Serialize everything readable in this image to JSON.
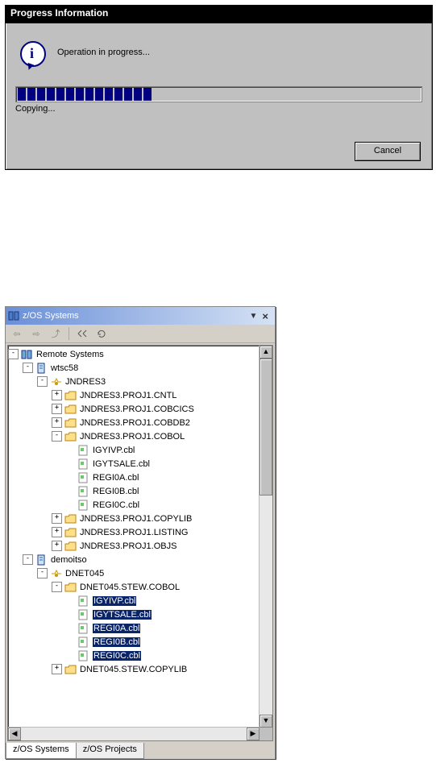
{
  "dialog": {
    "title": "Progress Information",
    "operation_text": "Operation in progress...",
    "status_text": "Copying...",
    "cancel_label": "Cancel",
    "progress_segments": 14
  },
  "view": {
    "title": "z/OS Systems",
    "tabs": [
      "z/OS Systems",
      "z/OS Projects"
    ],
    "active_tab": 0,
    "toolbar_icons": [
      "back-icon",
      "forward-icon",
      "up-icon",
      "connect-icon",
      "refresh-icon"
    ],
    "tree": [
      {
        "depth": 0,
        "expander": "-",
        "icon": "systems-icon",
        "label": "Remote Systems",
        "sel": false,
        "interact": true
      },
      {
        "depth": 1,
        "expander": "-",
        "icon": "host-icon",
        "label": "wtsc58",
        "sel": false,
        "interact": true
      },
      {
        "depth": 2,
        "expander": "-",
        "icon": "user-icon",
        "label": "JNDRES3",
        "sel": false,
        "interact": true
      },
      {
        "depth": 3,
        "expander": "+",
        "icon": "folder-icon",
        "label": "JNDRES3.PROJ1.CNTL",
        "sel": false,
        "interact": true
      },
      {
        "depth": 3,
        "expander": "+",
        "icon": "folder-icon",
        "label": "JNDRES3.PROJ1.COBCICS",
        "sel": false,
        "interact": true
      },
      {
        "depth": 3,
        "expander": "+",
        "icon": "folder-icon",
        "label": "JNDRES3.PROJ1.COBDB2",
        "sel": false,
        "interact": true
      },
      {
        "depth": 3,
        "expander": "-",
        "icon": "folder-icon",
        "label": "JNDRES3.PROJ1.COBOL",
        "sel": false,
        "interact": true
      },
      {
        "depth": 4,
        "expander": "",
        "icon": "file-icon",
        "label": "IGYIVP.cbl",
        "sel": false,
        "interact": true
      },
      {
        "depth": 4,
        "expander": "",
        "icon": "file-icon",
        "label": "IGYTSALE.cbl",
        "sel": false,
        "interact": true
      },
      {
        "depth": 4,
        "expander": "",
        "icon": "file-icon",
        "label": "REGI0A.cbl",
        "sel": false,
        "interact": true
      },
      {
        "depth": 4,
        "expander": "",
        "icon": "file-icon",
        "label": "REGI0B.cbl",
        "sel": false,
        "interact": true
      },
      {
        "depth": 4,
        "expander": "",
        "icon": "file-icon",
        "label": "REGI0C.cbl",
        "sel": false,
        "interact": true
      },
      {
        "depth": 3,
        "expander": "+",
        "icon": "folder-icon",
        "label": "JNDRES3.PROJ1.COPYLIB",
        "sel": false,
        "interact": true
      },
      {
        "depth": 3,
        "expander": "+",
        "icon": "folder-icon",
        "label": "JNDRES3.PROJ1.LISTING",
        "sel": false,
        "interact": true
      },
      {
        "depth": 3,
        "expander": "+",
        "icon": "folder-icon",
        "label": "JNDRES3.PROJ1.OBJS",
        "sel": false,
        "interact": true
      },
      {
        "depth": 1,
        "expander": "-",
        "icon": "host-icon",
        "label": "demoitso",
        "sel": false,
        "interact": true
      },
      {
        "depth": 2,
        "expander": "-",
        "icon": "user-icon",
        "label": "DNET045",
        "sel": false,
        "interact": true
      },
      {
        "depth": 3,
        "expander": "-",
        "icon": "folder-icon",
        "label": "DNET045.STEW.COBOL",
        "sel": false,
        "interact": true
      },
      {
        "depth": 4,
        "expander": "",
        "icon": "file-icon",
        "label": "IGYIVP.cbl",
        "sel": true,
        "interact": true
      },
      {
        "depth": 4,
        "expander": "",
        "icon": "file-icon",
        "label": "IGYTSALE.cbl",
        "sel": true,
        "interact": true
      },
      {
        "depth": 4,
        "expander": "",
        "icon": "file-icon",
        "label": "REGI0A.cbl",
        "sel": true,
        "interact": true
      },
      {
        "depth": 4,
        "expander": "",
        "icon": "file-icon",
        "label": "REGI0B.cbl",
        "sel": true,
        "interact": true
      },
      {
        "depth": 4,
        "expander": "",
        "icon": "file-icon",
        "label": "REGI0C.cbl",
        "sel": true,
        "interact": true
      },
      {
        "depth": 3,
        "expander": "+",
        "icon": "folder-icon",
        "label": "DNET045.STEW.COPYLIB",
        "sel": false,
        "interact": true
      }
    ]
  }
}
